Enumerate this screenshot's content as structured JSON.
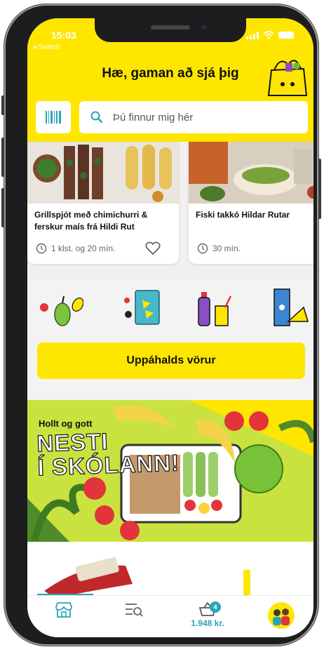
{
  "status": {
    "time": "15:03",
    "back": "◂ Search"
  },
  "header": {
    "greeting": "Hæ, gaman að sjá þig",
    "search_placeholder": "Þú finnur mig hér"
  },
  "recipes": [
    {
      "title": "Grillspjót með chimichurri & ferskur maís frá Hildi Rut",
      "time": "1 klst. og 20 mín."
    },
    {
      "title": "Fiski takkó Hildar Rutar",
      "time": "30 mín."
    }
  ],
  "categories": [
    {
      "icon": "fruit-icon"
    },
    {
      "icon": "snack-bag-icon"
    },
    {
      "icon": "drinks-icon"
    },
    {
      "icon": "dairy-cheese-icon"
    }
  ],
  "favorites_button": "Uppáhalds vörur",
  "banner": {
    "subtitle": "Hollt og gott",
    "headline_1": "NESTI",
    "headline_2": "Í SKÓLANN!"
  },
  "tabbar": {
    "items": [
      {
        "icon": "store-icon"
      },
      {
        "icon": "list-search-icon"
      },
      {
        "icon": "basket-icon",
        "badge": "4",
        "price": "1.948 kr."
      },
      {
        "icon": "profile-icon"
      }
    ]
  },
  "colors": {
    "brand_yellow": "#ffe600",
    "accent_teal": "#2aa5b5"
  }
}
